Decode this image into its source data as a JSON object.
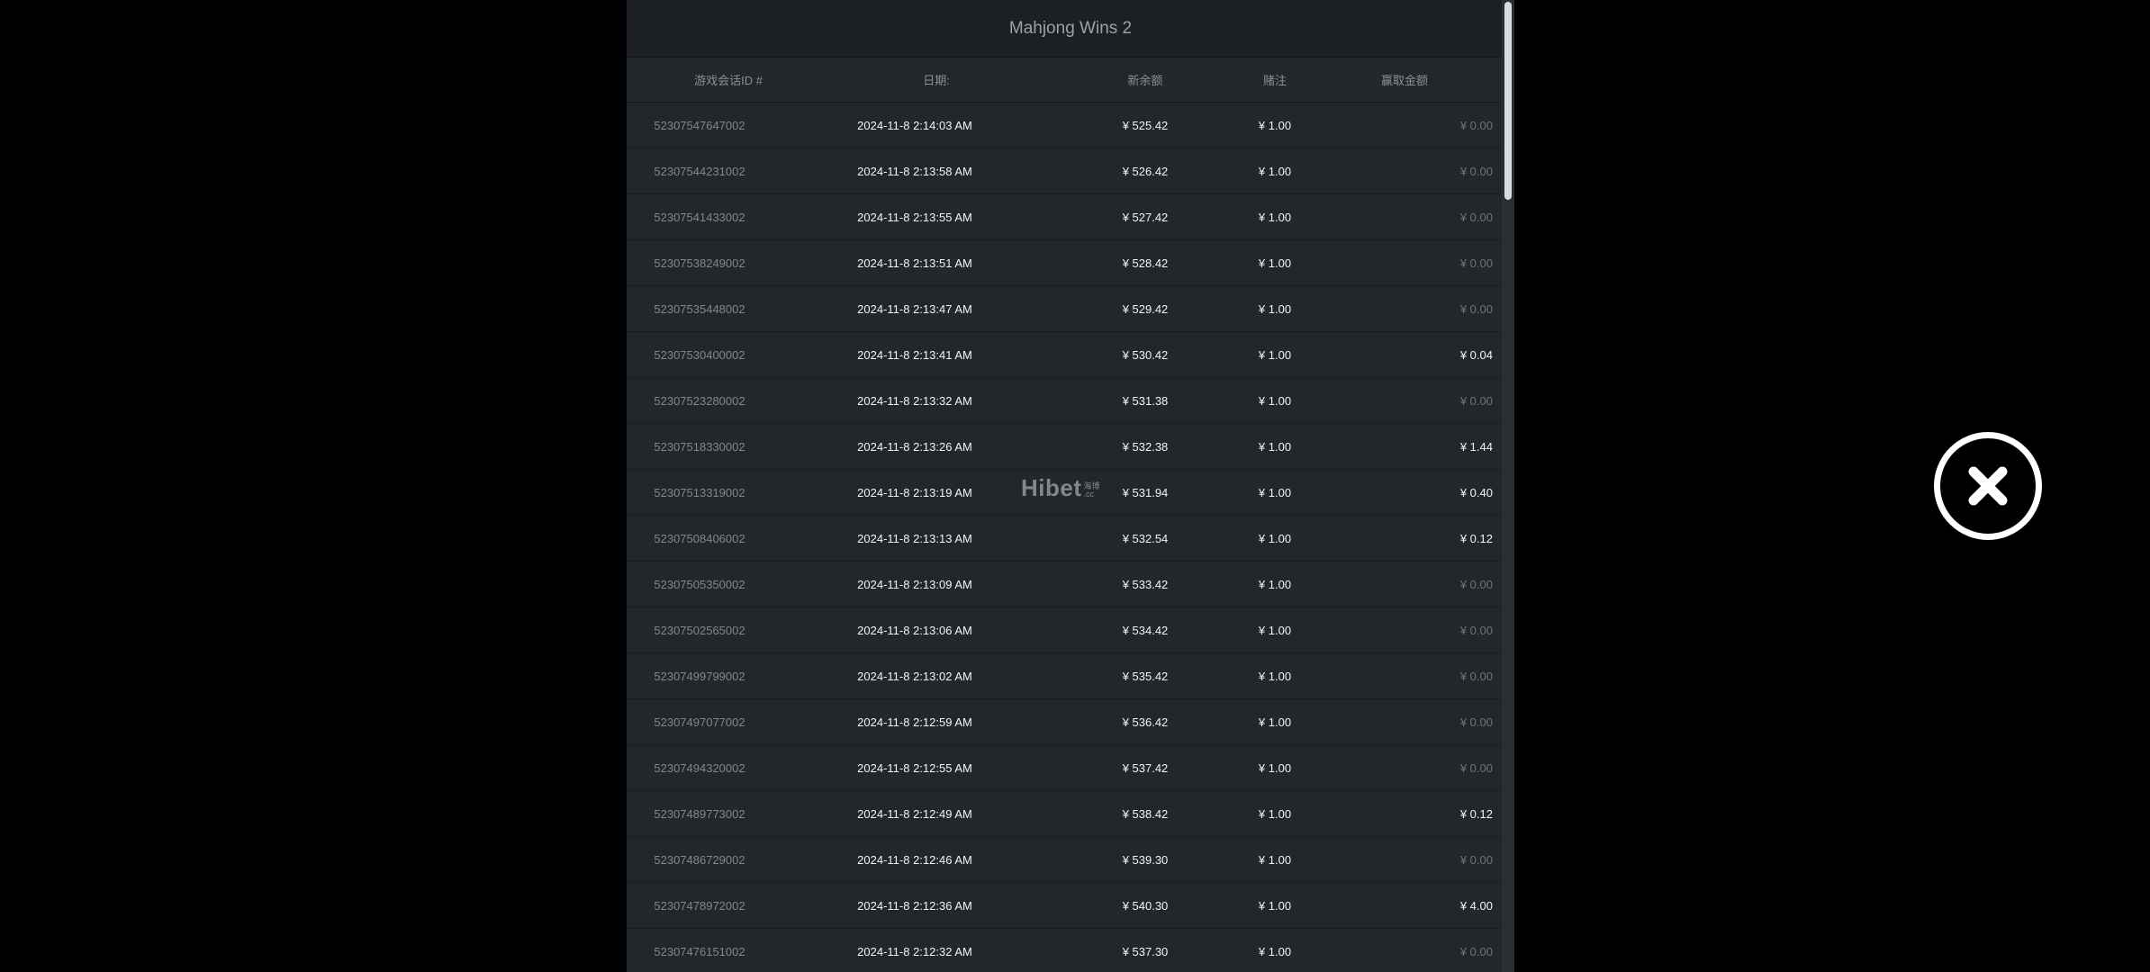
{
  "modal": {
    "title": "Mahjong Wins 2",
    "columns": {
      "id": "游戏会话ID #",
      "date": "日期:",
      "balance": "新余额",
      "bet": "赌注",
      "win": "赢取金额"
    },
    "rows": [
      {
        "id": "52307547647002",
        "date": "2024-11-8 2:14:03 AM",
        "balance": "¥ 525.42",
        "bet": "¥ 1.00",
        "win": "¥ 0.00",
        "win_positive": false
      },
      {
        "id": "52307544231002",
        "date": "2024-11-8 2:13:58 AM",
        "balance": "¥ 526.42",
        "bet": "¥ 1.00",
        "win": "¥ 0.00",
        "win_positive": false
      },
      {
        "id": "52307541433002",
        "date": "2024-11-8 2:13:55 AM",
        "balance": "¥ 527.42",
        "bet": "¥ 1.00",
        "win": "¥ 0.00",
        "win_positive": false
      },
      {
        "id": "52307538249002",
        "date": "2024-11-8 2:13:51 AM",
        "balance": "¥ 528.42",
        "bet": "¥ 1.00",
        "win": "¥ 0.00",
        "win_positive": false
      },
      {
        "id": "52307535448002",
        "date": "2024-11-8 2:13:47 AM",
        "balance": "¥ 529.42",
        "bet": "¥ 1.00",
        "win": "¥ 0.00",
        "win_positive": false
      },
      {
        "id": "52307530400002",
        "date": "2024-11-8 2:13:41 AM",
        "balance": "¥ 530.42",
        "bet": "¥ 1.00",
        "win": "¥ 0.04",
        "win_positive": true
      },
      {
        "id": "52307523280002",
        "date": "2024-11-8 2:13:32 AM",
        "balance": "¥ 531.38",
        "bet": "¥ 1.00",
        "win": "¥ 0.00",
        "win_positive": false
      },
      {
        "id": "52307518330002",
        "date": "2024-11-8 2:13:26 AM",
        "balance": "¥ 532.38",
        "bet": "¥ 1.00",
        "win": "¥ 1.44",
        "win_positive": true
      },
      {
        "id": "52307513319002",
        "date": "2024-11-8 2:13:19 AM",
        "balance": "¥ 531.94",
        "bet": "¥ 1.00",
        "win": "¥ 0.40",
        "win_positive": true
      },
      {
        "id": "52307508406002",
        "date": "2024-11-8 2:13:13 AM",
        "balance": "¥ 532.54",
        "bet": "¥ 1.00",
        "win": "¥ 0.12",
        "win_positive": true
      },
      {
        "id": "52307505350002",
        "date": "2024-11-8 2:13:09 AM",
        "balance": "¥ 533.42",
        "bet": "¥ 1.00",
        "win": "¥ 0.00",
        "win_positive": false
      },
      {
        "id": "52307502565002",
        "date": "2024-11-8 2:13:06 AM",
        "balance": "¥ 534.42",
        "bet": "¥ 1.00",
        "win": "¥ 0.00",
        "win_positive": false
      },
      {
        "id": "52307499799002",
        "date": "2024-11-8 2:13:02 AM",
        "balance": "¥ 535.42",
        "bet": "¥ 1.00",
        "win": "¥ 0.00",
        "win_positive": false
      },
      {
        "id": "52307497077002",
        "date": "2024-11-8 2:12:59 AM",
        "balance": "¥ 536.42",
        "bet": "¥ 1.00",
        "win": "¥ 0.00",
        "win_positive": false
      },
      {
        "id": "52307494320002",
        "date": "2024-11-8 2:12:55 AM",
        "balance": "¥ 537.42",
        "bet": "¥ 1.00",
        "win": "¥ 0.00",
        "win_positive": false
      },
      {
        "id": "52307489773002",
        "date": "2024-11-8 2:12:49 AM",
        "balance": "¥ 538.42",
        "bet": "¥ 1.00",
        "win": "¥ 0.12",
        "win_positive": true
      },
      {
        "id": "52307486729002",
        "date": "2024-11-8 2:12:46 AM",
        "balance": "¥ 539.30",
        "bet": "¥ 1.00",
        "win": "¥ 0.00",
        "win_positive": false
      },
      {
        "id": "52307478972002",
        "date": "2024-11-8 2:12:36 AM",
        "balance": "¥ 540.30",
        "bet": "¥ 1.00",
        "win": "¥ 4.00",
        "win_positive": true
      },
      {
        "id": "52307476151002",
        "date": "2024-11-8 2:12:32 AM",
        "balance": "¥ 537.30",
        "bet": "¥ 1.00",
        "win": "¥ 0.00",
        "win_positive": false
      }
    ]
  },
  "watermark": {
    "main": "Hibet",
    "sub": ".cc",
    "sub_top": "海博"
  },
  "close_button": {
    "icon": "close-icon"
  },
  "colors": {
    "panel_bg": "#22272b",
    "header_bg": "#1c2024",
    "zero_win": "#6d747a",
    "positive_win": "#f2f4f5"
  }
}
